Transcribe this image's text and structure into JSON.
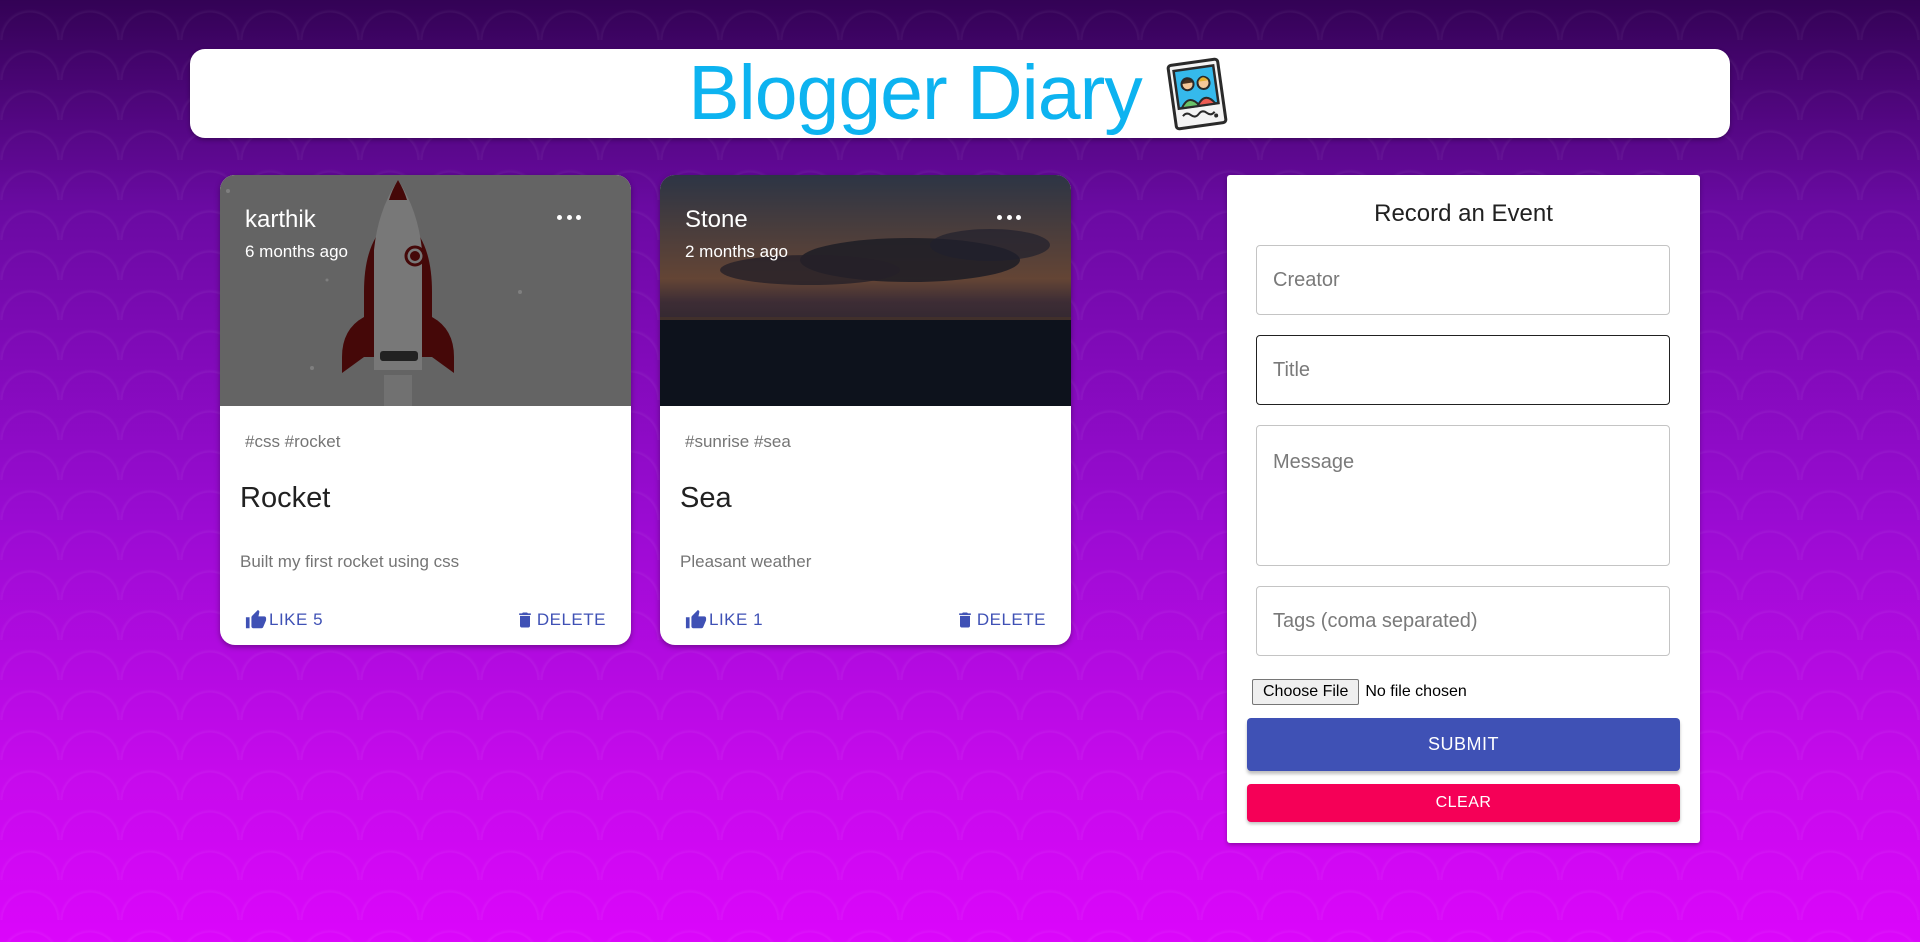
{
  "header": {
    "title": "Blogger Diary",
    "title_color": "#0db3f0",
    "logo_icon": "photo-polaroid-icon"
  },
  "posts": [
    {
      "creator": "karthik",
      "time": "6 months ago",
      "tags": "#css #rocket",
      "title": "Rocket",
      "message": "Built my first rocket using css",
      "like_label": "LIKE 5",
      "delete_label": "DELETE",
      "image": "rocket-illustration"
    },
    {
      "creator": "Stone",
      "time": "2 months ago",
      "tags": "#sunrise #sea",
      "title": "Sea",
      "message": "Pleasant weather",
      "like_label": "LIKE 1",
      "delete_label": "DELETE",
      "image": "sea-sunset-photo"
    }
  ],
  "form": {
    "heading": "Record an Event",
    "creator_placeholder": "Creator",
    "title_placeholder": "Title",
    "message_placeholder": "Message",
    "tags_placeholder": "Tags (coma separated)",
    "file_button": "Choose File",
    "file_status": "No file chosen",
    "submit_label": "SUBMIT",
    "clear_label": "CLEAR"
  },
  "colors": {
    "primary": "#3f51b5",
    "secondary": "#f50057",
    "background_top": "#330255",
    "background_bottom": "#db06fb"
  }
}
